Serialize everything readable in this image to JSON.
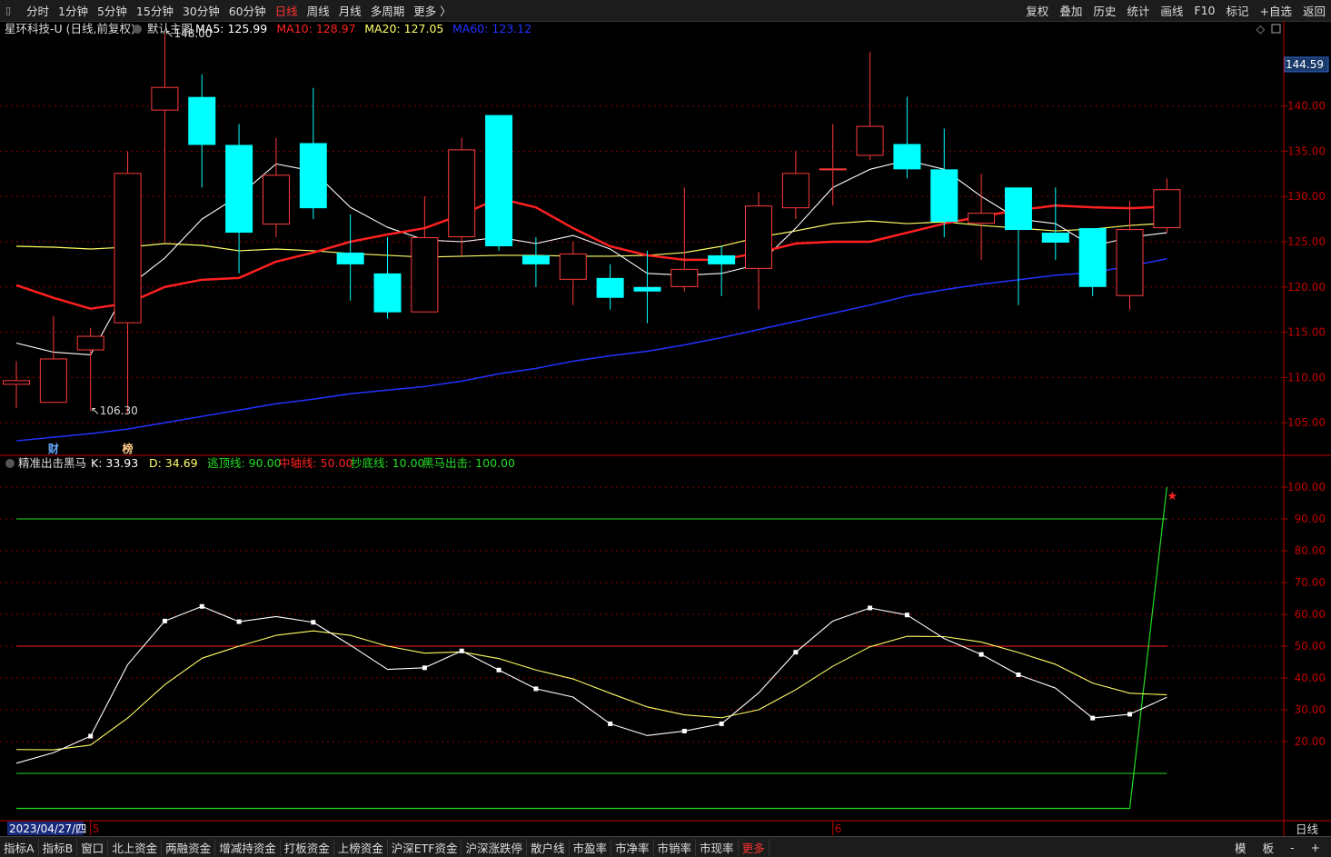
{
  "toolbar": {
    "items": [
      {
        "label": "分时",
        "active": false
      },
      {
        "label": "1分钟",
        "active": false
      },
      {
        "label": "5分钟",
        "active": false
      },
      {
        "label": "15分钟",
        "active": false
      },
      {
        "label": "30分钟",
        "active": false
      },
      {
        "label": "60分钟",
        "active": false
      },
      {
        "label": "日线",
        "active": true
      },
      {
        "label": "周线",
        "active": false
      },
      {
        "label": "月线",
        "active": false
      },
      {
        "label": "多周期",
        "active": false
      },
      {
        "label": "更多 〉",
        "active": false
      }
    ],
    "right_items": [
      "复权",
      "叠加",
      "历史",
      "统计",
      "画线",
      "F10",
      "标记",
      "+自选",
      "返回"
    ]
  },
  "bottom_bar": {
    "items": [
      {
        "label": "指标A",
        "highlight": false
      },
      {
        "label": "指标B",
        "highlight": false
      },
      {
        "label": "窗口",
        "highlight": false
      },
      {
        "label": "北上资金",
        "highlight": false
      },
      {
        "label": "两融资金",
        "highlight": false
      },
      {
        "label": "增减持资金",
        "highlight": false
      },
      {
        "label": "打板资金",
        "highlight": false
      },
      {
        "label": "上榜资金",
        "highlight": false
      },
      {
        "label": "沪深ETF资金",
        "highlight": false
      },
      {
        "label": "沪深涨跌停",
        "highlight": false
      },
      {
        "label": "散户线",
        "highlight": false
      },
      {
        "label": "市盈率",
        "highlight": false
      },
      {
        "label": "市净率",
        "highlight": false
      },
      {
        "label": "市销率",
        "highlight": false
      },
      {
        "label": "市现率",
        "highlight": false
      },
      {
        "label": "更多",
        "highlight": true
      }
    ],
    "right_items": [
      "模",
      "板",
      "-",
      "+"
    ]
  },
  "colors": {
    "up": "#ff3b3b",
    "down": "#00ffff",
    "ma5": "#ffffff",
    "ma10": "#ff2020",
    "ma20": "#ffff66",
    "ma60": "#2233ff",
    "grid": "#8a0000",
    "axis_border": "#c00000",
    "k_line": "#ffffff",
    "d_line": "#ffff66",
    "green_line": "#22dd22",
    "red_line": "#ff2020"
  },
  "chart_data": [
    {
      "type": "candlestick",
      "title": "星环科技-U (日线,前复权)",
      "template": "默认主图",
      "legend": [
        {
          "label": "MA5: 125.99",
          "color": "#ffffff"
        },
        {
          "label": "MA10: 128.97",
          "color": "#ff2020"
        },
        {
          "label": "MA20: 127.05",
          "color": "#ffff66"
        },
        {
          "label": "MA60: 123.12",
          "color": "#2233ff"
        }
      ],
      "ylim": [
        101.5,
        148.5
      ],
      "yticks": [
        105.0,
        110.0,
        115.0,
        120.0,
        125.0,
        130.0,
        135.0,
        140.0
      ],
      "current_price_label": "144.59",
      "current_price": 144.59,
      "annotations": [
        {
          "text": "148.00",
          "candle": 4,
          "value": 148.0
        },
        {
          "text": "106.30",
          "candle": 2,
          "value": 106.3
        }
      ],
      "markers": [
        {
          "text": "财",
          "candle": 1
        },
        {
          "text": "榜",
          "candle": 3
        }
      ],
      "candles": [
        {
          "o": 109.2,
          "h": 111.8,
          "l": 106.6,
          "c": 109.7
        },
        {
          "o": 107.2,
          "h": 116.8,
          "l": 107.2,
          "c": 112.1
        },
        {
          "o": 113.0,
          "h": 115.5,
          "l": 106.3,
          "c": 114.6
        },
        {
          "o": 116.0,
          "h": 135.0,
          "l": 106.0,
          "c": 132.6
        },
        {
          "o": 139.5,
          "h": 148.0,
          "l": 125.0,
          "c": 142.1
        },
        {
          "o": 141.0,
          "h": 143.5,
          "l": 131.0,
          "c": 135.7
        },
        {
          "o": 135.7,
          "h": 138.0,
          "l": 121.5,
          "c": 126.0
        },
        {
          "o": 126.9,
          "h": 136.5,
          "l": 125.5,
          "c": 132.4
        },
        {
          "o": 135.9,
          "h": 142.0,
          "l": 127.5,
          "c": 128.7
        },
        {
          "o": 123.8,
          "h": 128.0,
          "l": 118.5,
          "c": 122.5
        },
        {
          "o": 121.5,
          "h": 125.5,
          "l": 116.5,
          "c": 117.2
        },
        {
          "o": 117.2,
          "h": 130.0,
          "l": 117.2,
          "c": 125.5
        },
        {
          "o": 125.5,
          "h": 136.5,
          "l": 123.5,
          "c": 135.2
        },
        {
          "o": 139.0,
          "h": 139.0,
          "l": 124.0,
          "c": 124.5
        },
        {
          "o": 123.5,
          "h": 125.5,
          "l": 120.0,
          "c": 122.5
        },
        {
          "o": 120.8,
          "h": 125.0,
          "l": 118.0,
          "c": 123.7
        },
        {
          "o": 121.0,
          "h": 122.5,
          "l": 117.5,
          "c": 118.8
        },
        {
          "o": 120.0,
          "h": 124.0,
          "l": 116.0,
          "c": 119.5
        },
        {
          "o": 120.0,
          "h": 131.0,
          "l": 119.5,
          "c": 122.0
        },
        {
          "o": 123.5,
          "h": 124.5,
          "l": 119.0,
          "c": 122.5
        },
        {
          "o": 122.0,
          "h": 130.5,
          "l": 117.5,
          "c": 129.0
        },
        {
          "o": 128.7,
          "h": 135.0,
          "l": 127.5,
          "c": 132.6
        },
        {
          "o": 133.0,
          "h": 138.0,
          "l": 129.0,
          "c": 133.1
        },
        {
          "o": 134.5,
          "h": 146.0,
          "l": 134.0,
          "c": 137.8
        },
        {
          "o": 135.8,
          "h": 141.0,
          "l": 132.0,
          "c": 133.0
        },
        {
          "o": 133.0,
          "h": 137.5,
          "l": 125.5,
          "c": 127.2
        },
        {
          "o": 127.0,
          "h": 132.5,
          "l": 123.0,
          "c": 128.2
        },
        {
          "o": 131.0,
          "h": 131.0,
          "l": 118.0,
          "c": 126.3
        },
        {
          "o": 126.0,
          "h": 131.0,
          "l": 123.0,
          "c": 124.9
        },
        {
          "o": 126.5,
          "h": 126.5,
          "l": 119.0,
          "c": 120.0
        },
        {
          "o": 119.0,
          "h": 129.5,
          "l": 117.5,
          "c": 126.4
        },
        {
          "o": 126.5,
          "h": 132.0,
          "l": 126.0,
          "c": 130.8
        }
      ],
      "ma5": [
        113.8,
        112.8,
        112.5,
        120.0,
        123.2,
        127.5,
        130.1,
        133.6,
        132.8,
        128.8,
        126.6,
        125.2,
        125.0,
        125.5,
        124.8,
        125.7,
        124.2,
        121.5,
        121.3,
        121.5,
        122.5,
        126.5,
        131.0,
        133.0,
        134.0,
        133.0,
        130.0,
        127.5,
        127.0,
        124.5,
        125.5,
        126.0
      ],
      "ma10": [
        120.2,
        118.8,
        117.6,
        118.2,
        120.0,
        120.8,
        121.0,
        122.8,
        123.8,
        125.0,
        125.8,
        126.5,
        128.0,
        129.8,
        128.8,
        126.5,
        124.5,
        123.5,
        123.0,
        123.0,
        123.8,
        124.8,
        125.0,
        125.0,
        126.0,
        127.0,
        127.8,
        128.5,
        129.0,
        128.8,
        128.7,
        128.9
      ],
      "ma20": [
        124.5,
        124.4,
        124.2,
        124.4,
        124.8,
        124.6,
        124.0,
        124.2,
        124.0,
        123.7,
        123.5,
        123.3,
        123.4,
        123.5,
        123.5,
        123.4,
        123.4,
        123.5,
        123.8,
        124.5,
        125.5,
        126.2,
        127.0,
        127.3,
        127.0,
        127.2,
        126.8,
        126.5,
        126.2,
        126.4,
        126.8,
        127.05
      ],
      "ma60": [
        103.0,
        103.4,
        103.8,
        104.3,
        105.0,
        105.7,
        106.4,
        107.1,
        107.6,
        108.2,
        108.6,
        109.0,
        109.6,
        110.4,
        111.0,
        111.8,
        112.4,
        112.9,
        113.6,
        114.4,
        115.3,
        116.2,
        117.1,
        118.0,
        119.0,
        119.7,
        120.3,
        120.8,
        121.3,
        121.6,
        122.3,
        123.12
      ]
    },
    {
      "type": "line",
      "title": "精准出击黑马",
      "legend": [
        {
          "label": "K: 33.93",
          "color": "#ffffff"
        },
        {
          "label": "D: 34.69",
          "color": "#ffff66"
        },
        {
          "label": "逃顶线: 90.00",
          "color": "#22dd22"
        },
        {
          "label": "中轴线: 50.00",
          "color": "#ff2020"
        },
        {
          "label": "抄底线: 10.00",
          "color": "#22dd22"
        },
        {
          "label": "黑马出击: 100.00",
          "color": "#22dd22"
        }
      ],
      "ylim": [
        -4,
        104
      ],
      "yticks": [
        20.0,
        30.0,
        40.0,
        50.0,
        60.0,
        70.0,
        80.0,
        90.0,
        100.0
      ],
      "reference_lines": {
        "top": 90,
        "mid": 50,
        "bottom": 10
      },
      "x_labels": [
        {
          "text": "2023/04/27/四",
          "candle": 1
        },
        {
          "text": "5",
          "candle": 2
        },
        {
          "text": "6",
          "candle": 22
        }
      ],
      "period_label": "日线",
      "k": [
        13.2,
        16.5,
        21.7,
        44.2,
        57.9,
        62.5,
        57.7,
        59.3,
        57.5,
        50.3,
        42.7,
        43.2,
        48.5,
        42.5,
        36.6,
        34.0,
        25.6,
        21.9,
        23.3,
        25.6,
        35.3,
        48.1,
        57.9,
        62.0,
        59.8,
        52.4,
        47.4,
        41.0,
        36.8,
        27.4,
        28.6,
        33.93
      ],
      "d": [
        17.5,
        17.4,
        18.9,
        27.4,
        37.9,
        46.2,
        50.0,
        53.4,
        54.8,
        53.4,
        50.0,
        47.8,
        48.2,
        46.1,
        42.5,
        39.7,
        35.2,
        30.9,
        28.4,
        27.5,
        30.0,
        36.3,
        43.7,
        49.8,
        53.1,
        53.0,
        51.3,
        48.0,
        44.3,
        38.4,
        35.2,
        34.69
      ],
      "k_marked": [
        2,
        4,
        5,
        6,
        8,
        11,
        12,
        13,
        14,
        16,
        18,
        19,
        21,
        23,
        24,
        26,
        27,
        29,
        30
      ],
      "black_horse": [
        -1,
        -1,
        -1,
        -1,
        -1,
        -1,
        -1,
        -1,
        -1,
        -1,
        -1,
        -1,
        -1,
        -1,
        -1,
        -1,
        -1,
        -1,
        -1,
        -1,
        -1,
        -1,
        -1,
        -1,
        -1,
        -1,
        -1,
        -1,
        -1,
        -1,
        -1,
        100
      ],
      "star_candle": 31
    }
  ]
}
